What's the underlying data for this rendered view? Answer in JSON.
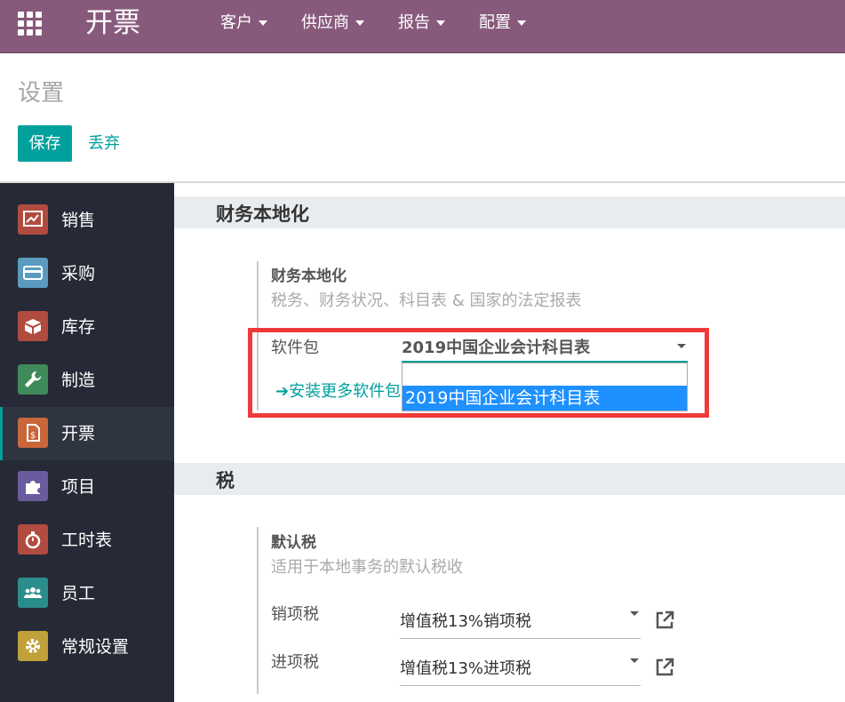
{
  "navbar": {
    "app_title": "开票",
    "menus": [
      {
        "label": "客户"
      },
      {
        "label": "供应商"
      },
      {
        "label": "报告"
      },
      {
        "label": "配置"
      }
    ],
    "color": "#875a7b"
  },
  "control_panel": {
    "title": "设置",
    "save_label": "保存",
    "discard_label": "丢弃",
    "accent": "#00a09d"
  },
  "sidebar": {
    "items": [
      {
        "label": "销售",
        "icon": "sales-chart-icon",
        "color": "#b24b3f"
      },
      {
        "label": "采购",
        "icon": "credit-card-icon",
        "color": "#5a9bbf"
      },
      {
        "label": "库存",
        "icon": "box-icon",
        "color": "#b24b3f"
      },
      {
        "label": "制造",
        "icon": "wrench-icon",
        "color": "#3f8a5a"
      },
      {
        "label": "开票",
        "icon": "invoice-dollar-icon",
        "color": "#c9663a",
        "active": true
      },
      {
        "label": "项目",
        "icon": "puzzle-icon",
        "color": "#6a5b9e"
      },
      {
        "label": "工时表",
        "icon": "stopwatch-icon",
        "color": "#b24b3f"
      },
      {
        "label": "员工",
        "icon": "users-icon",
        "color": "#2a8d8b"
      },
      {
        "label": "常规设置",
        "icon": "gear-icon",
        "color": "#c0a13a"
      }
    ]
  },
  "localization": {
    "section_title": "财务本地化",
    "box_title": "财务本地化",
    "box_desc": "税务、财务状况、科目表 & 国家的法定报表",
    "package_label": "软件包",
    "package_value": "2019中国企业会计科目表",
    "install_link": "安装更多软件包",
    "dropdown_option": "2019中国企业会计科目表"
  },
  "taxes": {
    "section_title": "税",
    "box_title": "默认税",
    "box_desc": "适用于本地事务的默认税收",
    "sales_label": "销项税",
    "sales_value": "增值税13%销项税",
    "purchase_label": "进项税",
    "purchase_value": "增值税13%进项税"
  }
}
